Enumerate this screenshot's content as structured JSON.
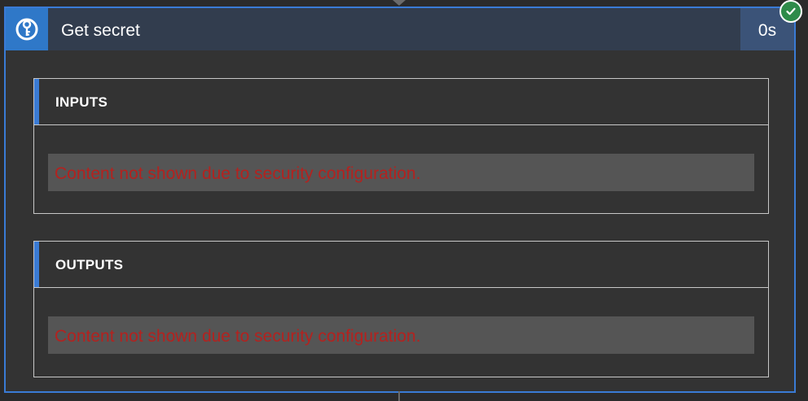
{
  "action": {
    "title": "Get secret",
    "duration": "0s",
    "status_icon": "checkmark-icon",
    "action_icon": "key-vault-icon",
    "colors": {
      "accent": "#3a7bd5",
      "header_bg": "#323d4e",
      "duration_bg": "#3b5378",
      "success": "#2e8b4a",
      "error_text": "#b3221f"
    }
  },
  "inputs": {
    "label": "INPUTS",
    "message": "Content not shown due to security configuration."
  },
  "outputs": {
    "label": "OUTPUTS",
    "message": "Content not shown due to security configuration."
  }
}
